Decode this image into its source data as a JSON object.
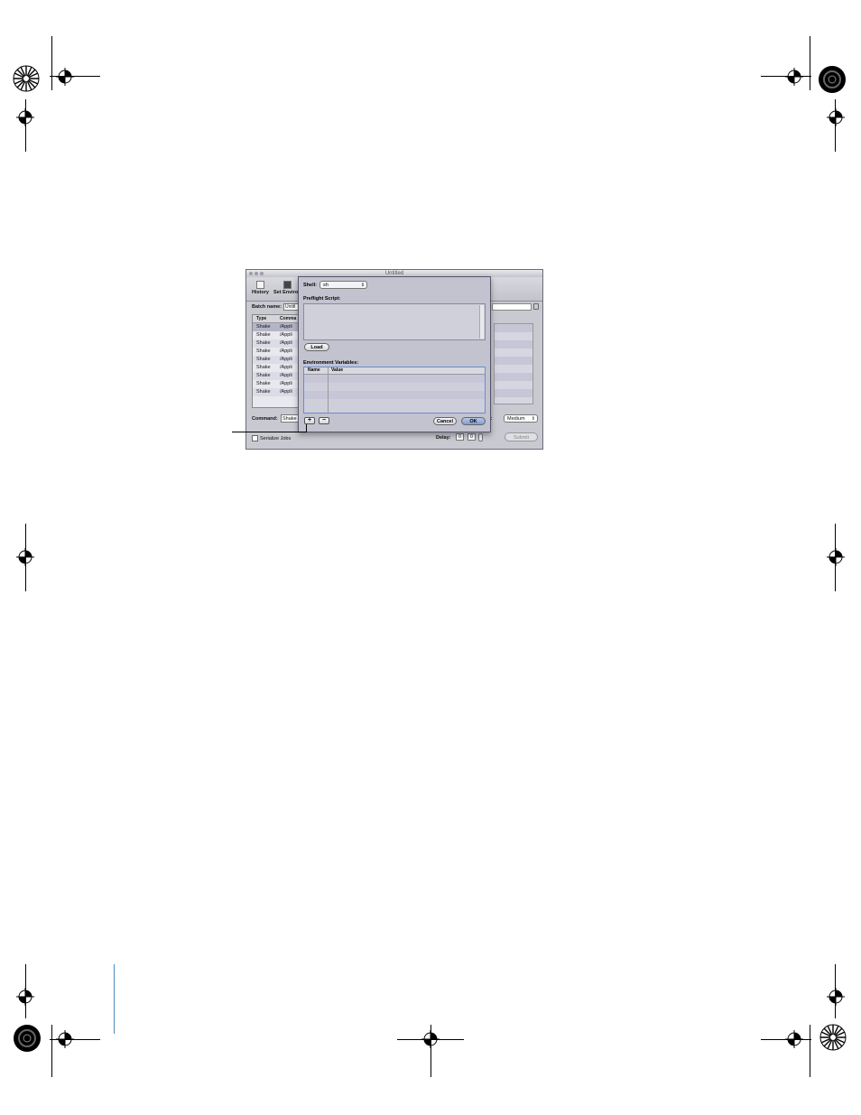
{
  "window": {
    "title": "Untitled",
    "toolbar": [
      {
        "label": "History",
        "icon": "history-icon"
      },
      {
        "label": "Set Environ",
        "icon": "environment-icon"
      }
    ],
    "batch_name_label": "Batch name:",
    "batch_name_value": "Untitl",
    "table": {
      "headers": [
        "Type",
        "Comma"
      ],
      "rows": [
        [
          "Shake",
          "/Appli"
        ],
        [
          "Shake",
          "/Appli"
        ],
        [
          "Shake",
          "/Appli"
        ],
        [
          "Shake",
          "/Appli"
        ],
        [
          "Shake",
          "/Appli"
        ],
        [
          "Shake",
          "/Appli"
        ],
        [
          "Shake",
          "/Appli"
        ],
        [
          "Shake",
          "/Appli"
        ],
        [
          "Shake",
          "/Appli"
        ]
      ]
    },
    "command_label": "Command:",
    "command_value": "Shake",
    "priority_label": "ity:",
    "priority_value": "Medium",
    "serialize_label": "Serialize Jobs",
    "delay_label": "Delay:",
    "delay_values": [
      "0",
      "0"
    ],
    "submit_label": "Submit"
  },
  "sheet": {
    "shell_label": "Shell:",
    "shell_value": "sh",
    "preflight_label": "Preflight Script:",
    "load_label": "Load",
    "env_label": "Environment Variables:",
    "env_headers": [
      "Name",
      "Value"
    ],
    "add_label": "+",
    "remove_label": "−",
    "cancel_label": "Cancel",
    "ok_label": "OK"
  }
}
